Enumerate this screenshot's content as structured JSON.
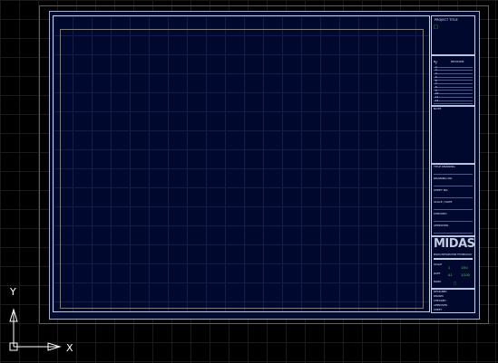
{
  "title_block": {
    "project_title": "PROJECT TITLE",
    "status_mark": "□",
    "revision_header_no": "No.",
    "revision_header_desc": "REVISION",
    "revision_rows": [
      "1",
      "2",
      "3",
      "4",
      "5",
      "6",
      "7",
      "8",
      "9",
      "10",
      "11",
      "12"
    ],
    "notes_label": "NOTE",
    "fields": [
      {
        "label": "TITLE DRAWING"
      },
      {
        "label": "DRAWING NO."
      },
      {
        "label": "SHEET NO."
      },
      {
        "label": "SCALE / DATE"
      },
      {
        "label": "CHECKED"
      },
      {
        "label": "APPROVED"
      }
    ],
    "logo_text": "MIDAS",
    "logo_subtitle": "MIDAS INFORMATION TECHNOLOGY",
    "scale_label": "SCALE",
    "scale_values": [
      "1",
      "1/50"
    ],
    "date_label": "DATE",
    "date_values": [
      "A1",
      "1/100"
    ],
    "mark_label": "MARK",
    "mark_value": "□",
    "footer_lines": [
      "DESIGNED",
      "DRAWN",
      "CHECKED",
      "APPROVED",
      "SHEET"
    ]
  },
  "ucs": {
    "x_label": "X",
    "y_label": "Y"
  }
}
